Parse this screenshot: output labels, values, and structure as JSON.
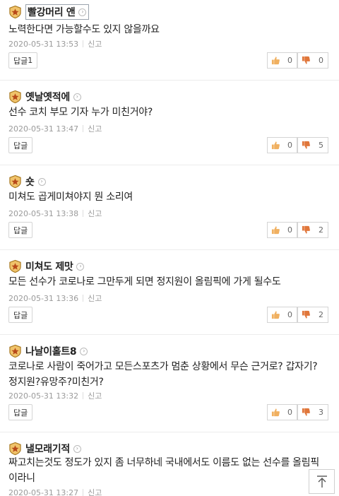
{
  "reply_label": "답글",
  "report_label": "신고",
  "comments": [
    {
      "nickname": "빨강머리 앤",
      "chevron": "›",
      "lines": [
        "노력한다면 가능할수도 있지 않을까요"
      ],
      "timestamp": "2020-05-31 13:53",
      "reply_count": "1",
      "likes": "0",
      "dislikes": "0"
    },
    {
      "nickname": "옛날옛적에",
      "chevron": "›",
      "lines": [
        "선수 코치 부모 기자 누가 미친거야?"
      ],
      "timestamp": "2020-05-31 13:47",
      "reply_count": "",
      "likes": "0",
      "dislikes": "5"
    },
    {
      "nickname": "숏",
      "chevron": "›",
      "lines": [
        "미쳐도 곱게미쳐야지 뭔 소리여"
      ],
      "timestamp": "2020-05-31 13:38",
      "reply_count": "",
      "likes": "0",
      "dislikes": "2"
    },
    {
      "nickname": "미쳐도 제맛",
      "chevron": "›",
      "lines": [
        "모든 선수가 코로나로 그만두게 되면 정지원이 올림픽에 가게 될수도"
      ],
      "timestamp": "2020-05-31 13:36",
      "reply_count": "",
      "likes": "0",
      "dislikes": "2"
    },
    {
      "nickname": "나날이홀트8",
      "chevron": "›",
      "lines": [
        "코로나로 사람이 죽어가고 모든스포츠가 멈춘 상황에서 무슨 근거로? 갑자기?",
        "정지원?유망주?미친거?"
      ],
      "timestamp": "2020-05-31 13:32",
      "reply_count": "",
      "likes": "0",
      "dislikes": "3"
    },
    {
      "nickname": "낼모래기적",
      "chevron": "›",
      "lines": [
        "짜고치는것도 정도가 있지 좀 너무하네 국내에서도 이름도 없는 선수를 올림픽",
        "이라니"
      ],
      "timestamp": "2020-05-31 13:27",
      "reply_count": "",
      "likes": "",
      "dislikes": ""
    }
  ],
  "scroll_top_icon": "arrow-up-icon"
}
